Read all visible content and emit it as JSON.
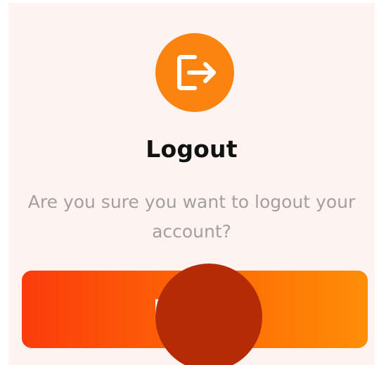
{
  "dialog": {
    "icon": "logout-icon",
    "title": "Logout",
    "message": "Are you sure you want to logout your account?",
    "confirm_button": {
      "label": "Logout"
    }
  },
  "colors": {
    "accent": "#fb8410",
    "button_gradient_start": "#fb3c0c",
    "button_gradient_end": "#fe8e07",
    "background": "#fdf4f2",
    "title_text": "#111111",
    "message_text": "#a39f9f",
    "touch_indicator": "#b42b06"
  }
}
